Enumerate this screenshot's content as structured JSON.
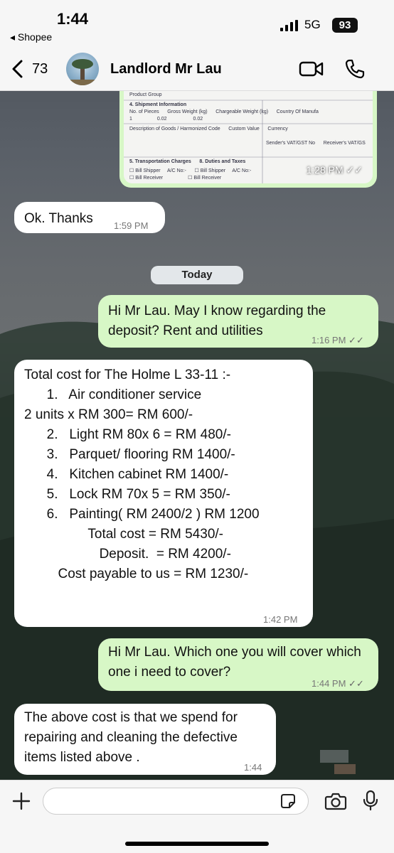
{
  "status_bar": {
    "time": "1:44",
    "back_app": "◂ Shopee",
    "network": "5G",
    "battery": "93"
  },
  "header": {
    "back_count": "73",
    "contact_name": "Landlord Mr Lau"
  },
  "messages": {
    "image_msg": {
      "time": "1:28 PM",
      "form_lines": [
        "Product Group",
        "4. Shipment Information",
        "No. of Pieces      Gross Weight (kg)      Chargeable Weight (kg)      Country Of Manufa",
        "1                  0.02                   0.02",
        "Description of Goods / Harmonized Code      Custom Value      Currency",
        "Sender's VAT/GST No      Receiver's VAT/GS",
        "5. Transportation Charges      8. Duties and Taxes",
        "☐ Bill Shipper     A/C No:-      ☐ Bill Shipper     A/C No:-",
        "☐ Bill Receiver                  ☐ Bill Receiver"
      ]
    },
    "ok_thanks": {
      "text": "Ok. Thanks",
      "time": "1:59 PM"
    },
    "date_label": "Today",
    "deposit_question": {
      "text": "Hi Mr Lau. May I know regarding the deposit? Rent and utilities",
      "time": "1:16 PM"
    },
    "cost_list": {
      "lines": [
        "Total cost for The Holme L 33-11 :-",
        "",
        "      1.   Air conditioner service",
        "2 units x RM 300= RM 600/-",
        "      2.   Light RM 80x 6 = RM 480/-",
        "      3.   Parquet/ flooring RM 1400/-",
        "      4.   Kitchen cabinet RM 1400/-",
        "      5.   Lock RM 70x 5 = RM 350/-",
        "      6.   Painting( RM 2400/2 ) RM 1200",
        "                 Total cost = RM 5430/-",
        "                    Deposit.  = RM 4200/-",
        "         Cost payable to us = RM 1230/-"
      ],
      "time": "1:42 PM"
    },
    "cover_question": {
      "text": "Hi Mr Lau. Which one you will cover which one i need to cover?",
      "time": "1:44 PM"
    },
    "reply_above_cost": {
      "text": "The above cost is that we spend for repairing and cleaning the defective items listed above .",
      "time": "1:44 PM"
    }
  },
  "composer": {
    "placeholder": ""
  },
  "colors": {
    "outgoing_bubble": "#d7f7c6",
    "incoming_bubble": "#ffffff",
    "bar_background": "#f6f6f6"
  },
  "icons": [
    "back-chevron-icon",
    "video-call-icon",
    "phone-call-icon",
    "plus-icon",
    "sticker-icon",
    "camera-icon",
    "microphone-icon",
    "double-check-icon"
  ]
}
